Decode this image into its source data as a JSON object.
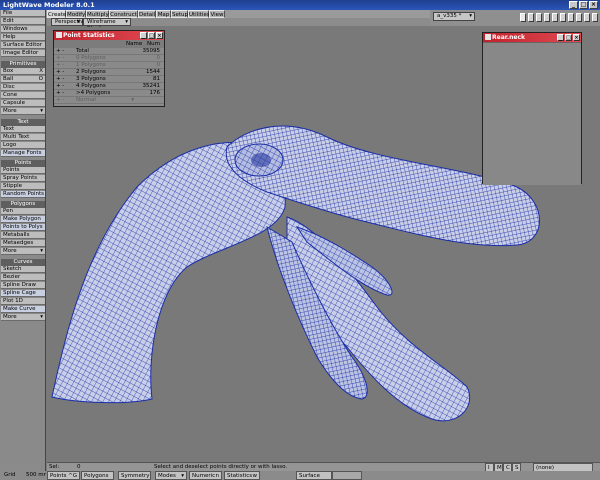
{
  "app": {
    "title": "LightWave Modeler 8.0.1"
  },
  "tabs": [
    "Create",
    "Modify",
    "Multiply",
    "Construct",
    "Detail",
    "Map",
    "Setup",
    "Utilities",
    "View"
  ],
  "active_tab": "Create",
  "left_top": [
    "File",
    "Edit",
    "Windows",
    "Help",
    "Surface Editor",
    "Image Editor"
  ],
  "sections": {
    "primitives": {
      "header": "Primitives",
      "items": [
        "Box",
        "Ball",
        "Disc",
        "Cone",
        "Capsule",
        "More"
      ],
      "shortcuts": [
        "X",
        "O",
        "",
        "",
        "",
        ""
      ]
    },
    "text": {
      "header": "Text",
      "items": [
        "Text",
        "Multi Text",
        "Logo",
        "Manage Fonts"
      ]
    },
    "points": {
      "header": "Points",
      "items": [
        "Points",
        "Spray Points",
        "Stipple",
        "Random Points"
      ]
    },
    "polygons": {
      "header": "Polygons",
      "items": [
        "Pen",
        "Make Polygon",
        "Points to Polys",
        "Metaballs",
        "Metaedges",
        "More"
      ]
    },
    "curves": {
      "header": "Curves",
      "items": [
        "Sketch",
        "Bezier",
        "Spline Draw",
        "Spline Cage",
        "Plot 1D",
        "Make Curve",
        "More"
      ]
    }
  },
  "viewport_row": {
    "view_mode": "Perspective",
    "shade_mode": "Wireframe Shade"
  },
  "layer_field": "a_v335 *",
  "point_stats": {
    "title": "Point Statistics",
    "col_name": "Name",
    "col_num": "Num",
    "rows": [
      {
        "label": "Total",
        "value": "35095",
        "dim": false
      },
      {
        "label": "0 Polygons",
        "value": "0",
        "dim": true
      },
      {
        "label": "1 Polygons",
        "value": "0",
        "dim": true
      },
      {
        "label": "2 Polygons",
        "value": "1544",
        "dim": false
      },
      {
        "label": "3 Polygons",
        "value": "81",
        "dim": false
      },
      {
        "label": "4 Polygons",
        "value": "35241",
        "dim": false
      },
      {
        "label": ">4 Polygons",
        "value": "176",
        "dim": false
      },
      {
        "label": "Normal",
        "value": "",
        "dim": true
      }
    ]
  },
  "float_window": {
    "title": "Rear.neck"
  },
  "status": {
    "sel_label": "Sel:",
    "sel_value": "0",
    "message": "Select and deselect points directly or with lasso.",
    "buttons": [
      "I",
      "M",
      "C",
      "S"
    ],
    "layer_select": "(none)"
  },
  "bottom": {
    "grid_label": "Grid",
    "grid_value": "500 mm",
    "mode_buttons": [
      "Points",
      "Polygons",
      "Symmetry",
      "Modes",
      "Numeric",
      "Statistics",
      "Surface"
    ],
    "points_shortcut": "^G",
    "numeric_shortcut": "n",
    "statistics_shortcut": "w"
  },
  "colors": {
    "mesh": "#1a2ea8",
    "viewport_bg": "#797979",
    "title_red": "#c2222c",
    "title_blue": "#1f3f8f"
  }
}
